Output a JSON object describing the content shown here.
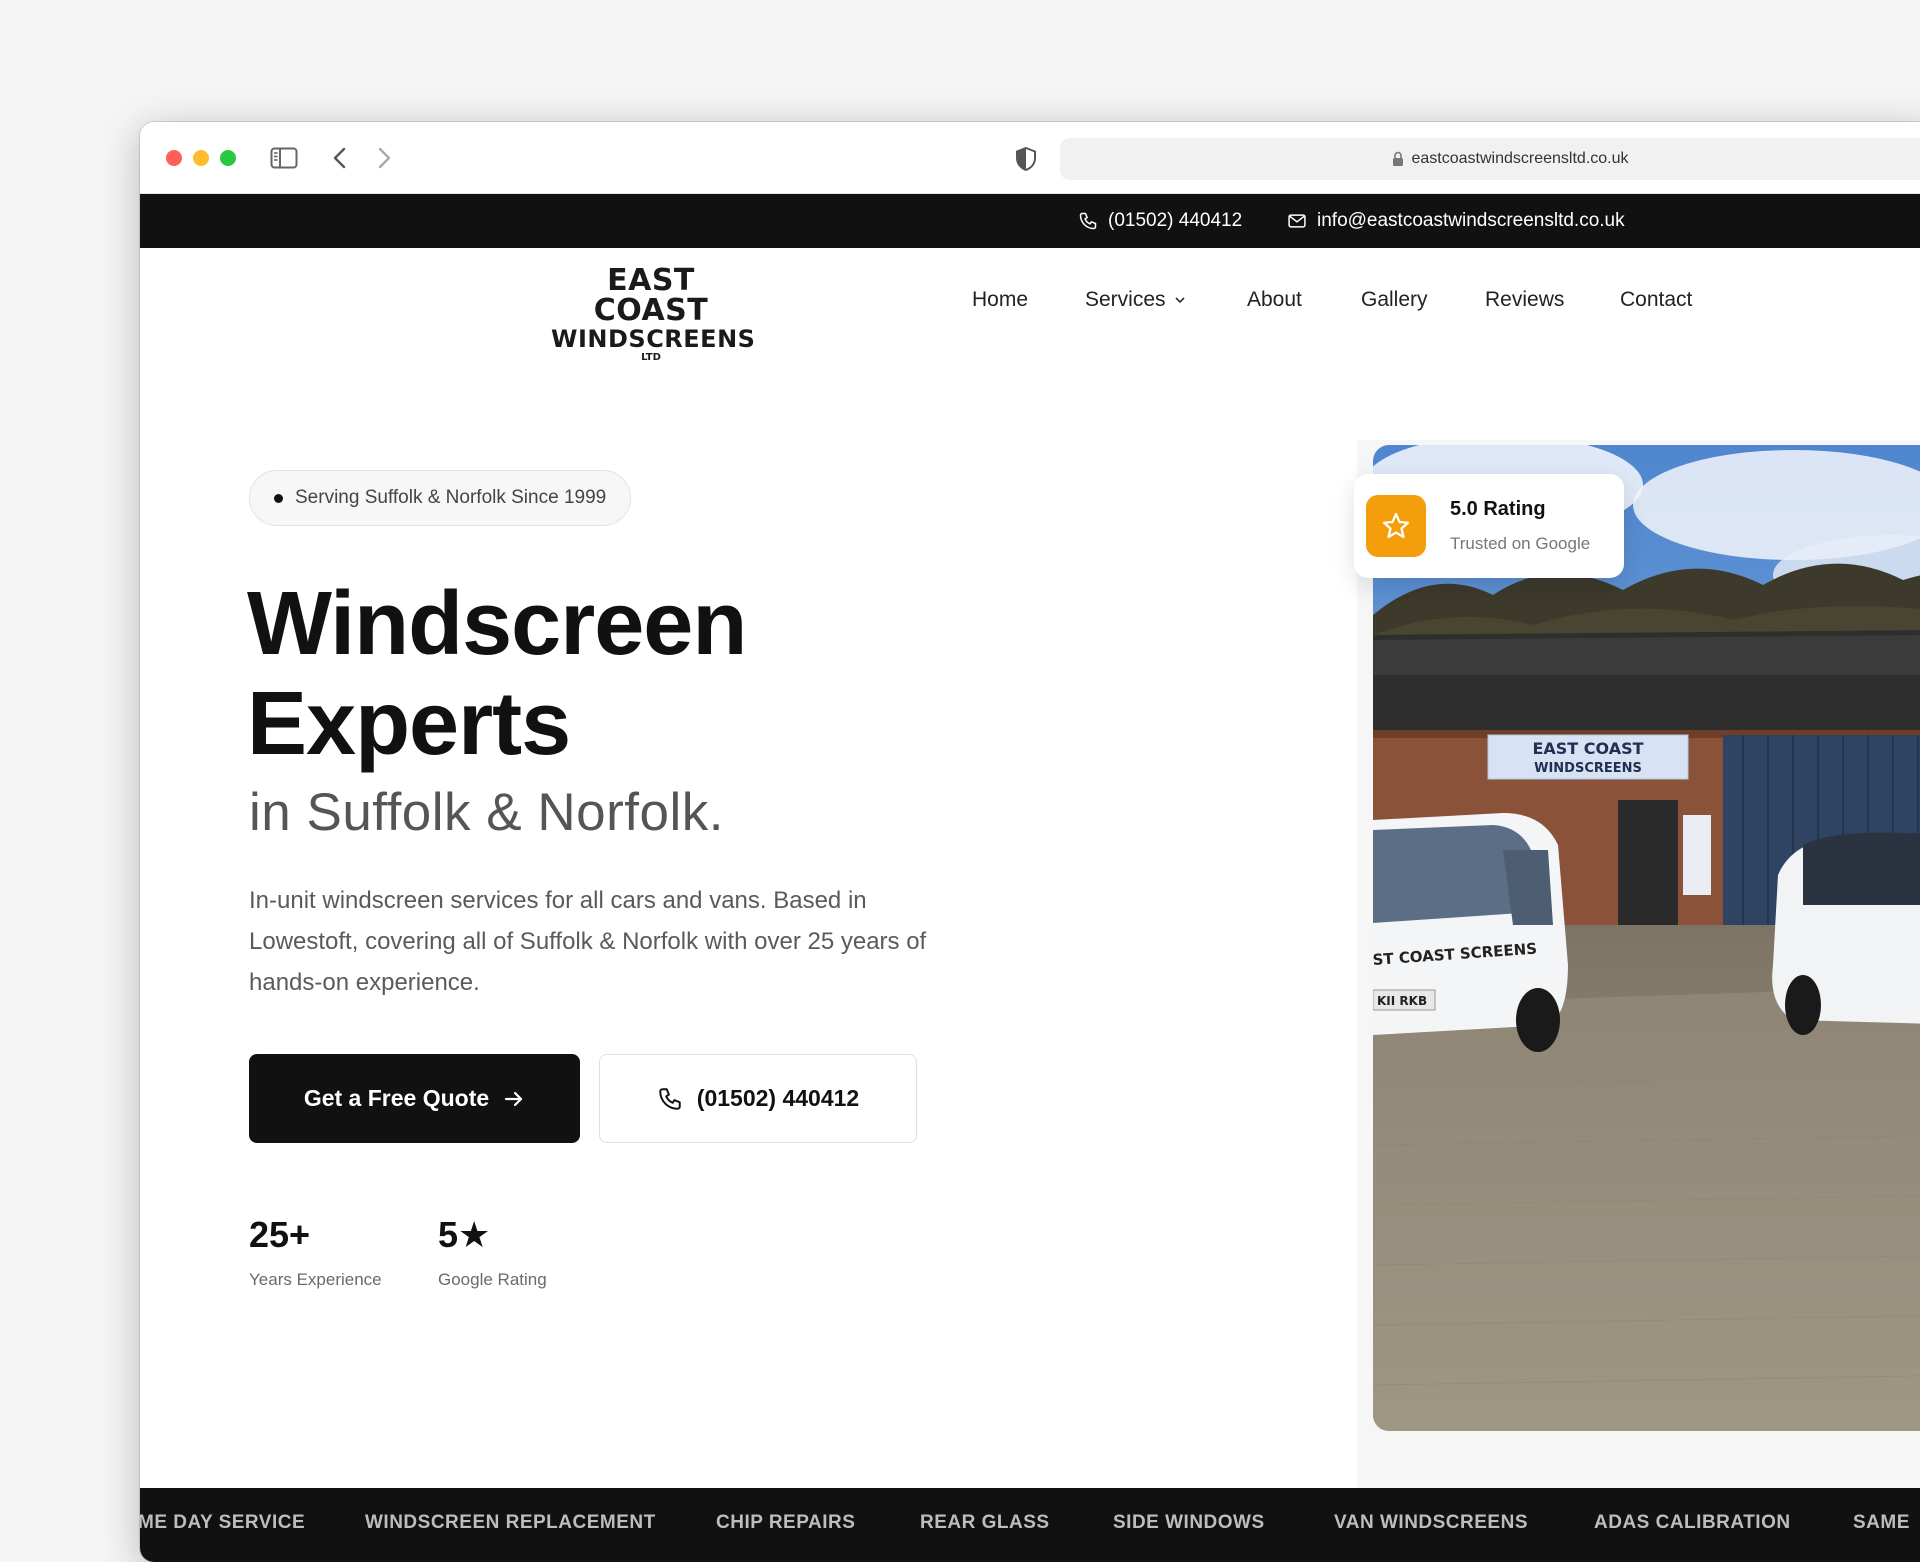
{
  "browser": {
    "url": "eastcoastwindscreensltd.co.uk"
  },
  "topbar": {
    "phone": "(01502) 440412",
    "email": "info@eastcoastwindscreensltd.co.uk"
  },
  "logo": {
    "line1": "EAST COAST",
    "line2": "WINDSCREENS",
    "line3": "LTD"
  },
  "nav": {
    "items": [
      {
        "label": "Home"
      },
      {
        "label": "Services"
      },
      {
        "label": "About"
      },
      {
        "label": "Gallery"
      },
      {
        "label": "Reviews"
      },
      {
        "label": "Contact"
      }
    ]
  },
  "hero": {
    "badge": "Serving Suffolk & Norfolk Since 1999",
    "title_line1": "Windscreen",
    "title_line2": "Experts",
    "subtitle": "in Suffolk & Norfolk.",
    "description": "In-unit windscreen services for all cars and vans. Based in Lowestoft, covering all of Suffolk & Norfolk with over 25 years of hands-on experience.",
    "cta_primary": "Get a Free Quote",
    "cta_secondary": "(01502) 440412"
  },
  "stats": [
    {
      "value": "25+",
      "label": "Years Experience"
    },
    {
      "value": "5★",
      "label": "Google Rating"
    }
  ],
  "rating_card": {
    "title": "5.0 Rating",
    "subtitle": "Trusted on Google"
  },
  "photo_signage": {
    "sign_line1": "EAST COAST",
    "sign_line2": "WINDSCREENS",
    "van_text": "ST COAST SCREENS",
    "plate": "KII RKB"
  },
  "marquee": {
    "items": [
      "ME DAY SERVICE",
      "WINDSCREEN REPLACEMENT",
      "CHIP REPAIRS",
      "REAR GLASS",
      "SIDE WINDOWS",
      "VAN WINDSCREENS",
      "ADAS CALIBRATION",
      "SAME"
    ]
  },
  "colors": {
    "brand_dark": "#111111",
    "accent_star": "#f59e0b"
  }
}
